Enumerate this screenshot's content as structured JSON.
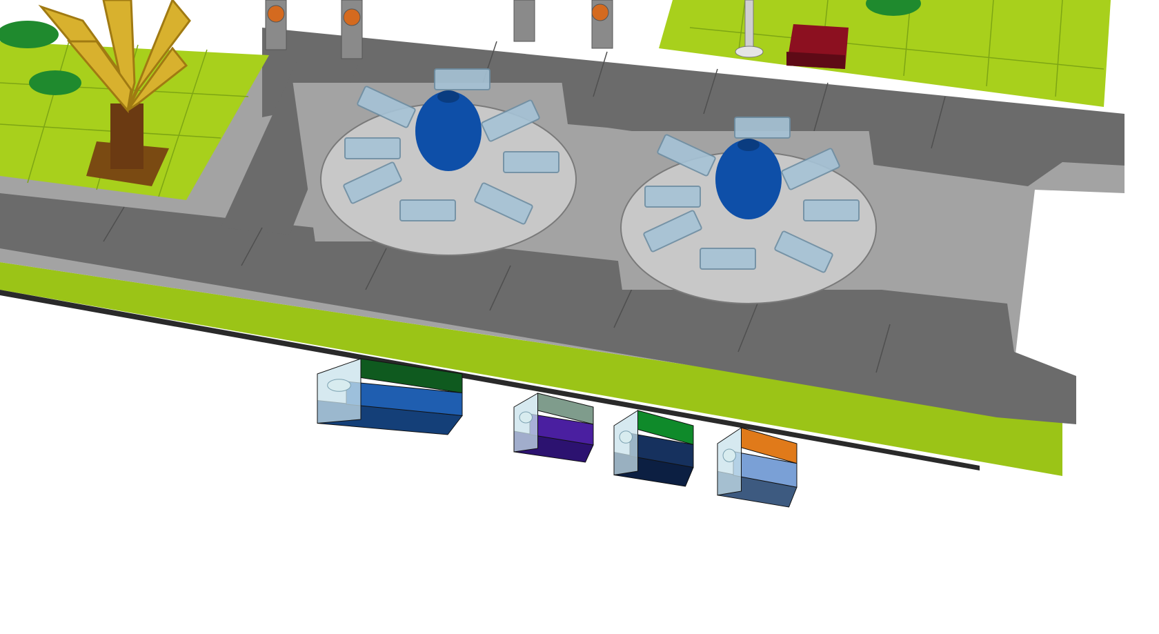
{
  "scene": {
    "subject": "",
    "colors": {
      "background": "#ffffff",
      "baseplate_green": "#9bc417",
      "grass_tile": "#a8d01c",
      "road_dark": "#6b6b6b",
      "sidewalk_light": "#a3a3a3",
      "fountain_center": "#0e4fa8",
      "fountain_arms": "#a6c3d6",
      "tree_trunk": "#6b3a12",
      "tree_leaves": "#d8b12e",
      "bench": "#8c1020",
      "bush_green": "#1f8a2e"
    },
    "brick_stacks": [
      {
        "top": "#0f5a1f",
        "front": "#1f5eb0",
        "side": "#143f78"
      },
      {
        "top": "#7f9c8c",
        "front": "#4a1fa0",
        "side": "#2c1270"
      },
      {
        "top": "#0f8a2a",
        "front": "#16315e",
        "side": "#0c1f42"
      },
      {
        "top": "#e07a1a",
        "front": "#7aa0d6",
        "side": "#3d5a80"
      }
    ]
  }
}
